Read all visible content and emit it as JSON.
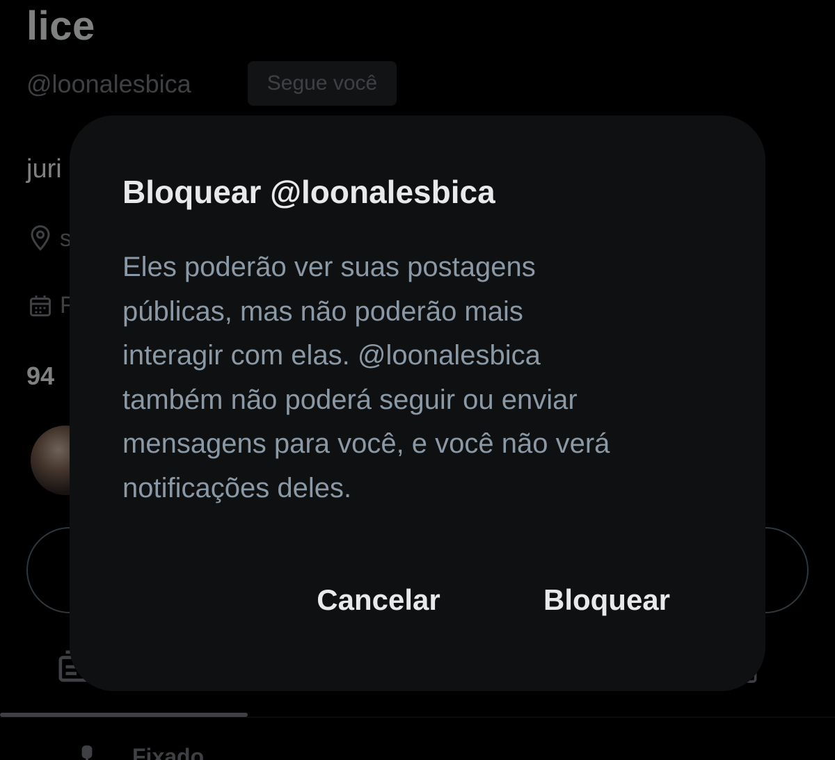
{
  "profile": {
    "display_name_fragment": "lice",
    "handle": "@loonalesbica",
    "follows_you_badge": "Segue você",
    "bio_fragment": "juri",
    "location_fragment": "s",
    "joined_fragment": "F",
    "stats_fragment": "94",
    "pinned_label": "Fixado",
    "icons": {
      "location": "location-pin-icon",
      "calendar": "calendar-icon",
      "tab_left": "tab-feed-icon",
      "tab_right": "tab-list-icon",
      "pinned": "pin-icon"
    }
  },
  "dialog": {
    "title": "Bloquear @loonalesbica",
    "body_lines": [
      "Eles poderão ver suas postagens",
      "públicas, mas não poderão mais",
      "interagir com elas. @loonalesbica",
      "também não poderá seguir ou enviar",
      "mensagens para você, e você não verá",
      "notificações deles."
    ],
    "cancel_label": "Cancelar",
    "confirm_label": "Bloquear"
  },
  "colors": {
    "background": "#000000",
    "dialog_background": "#0e1011",
    "primary_text": "#e7e9ea",
    "secondary_text": "#8b98a5",
    "muted_text": "#71767b"
  }
}
